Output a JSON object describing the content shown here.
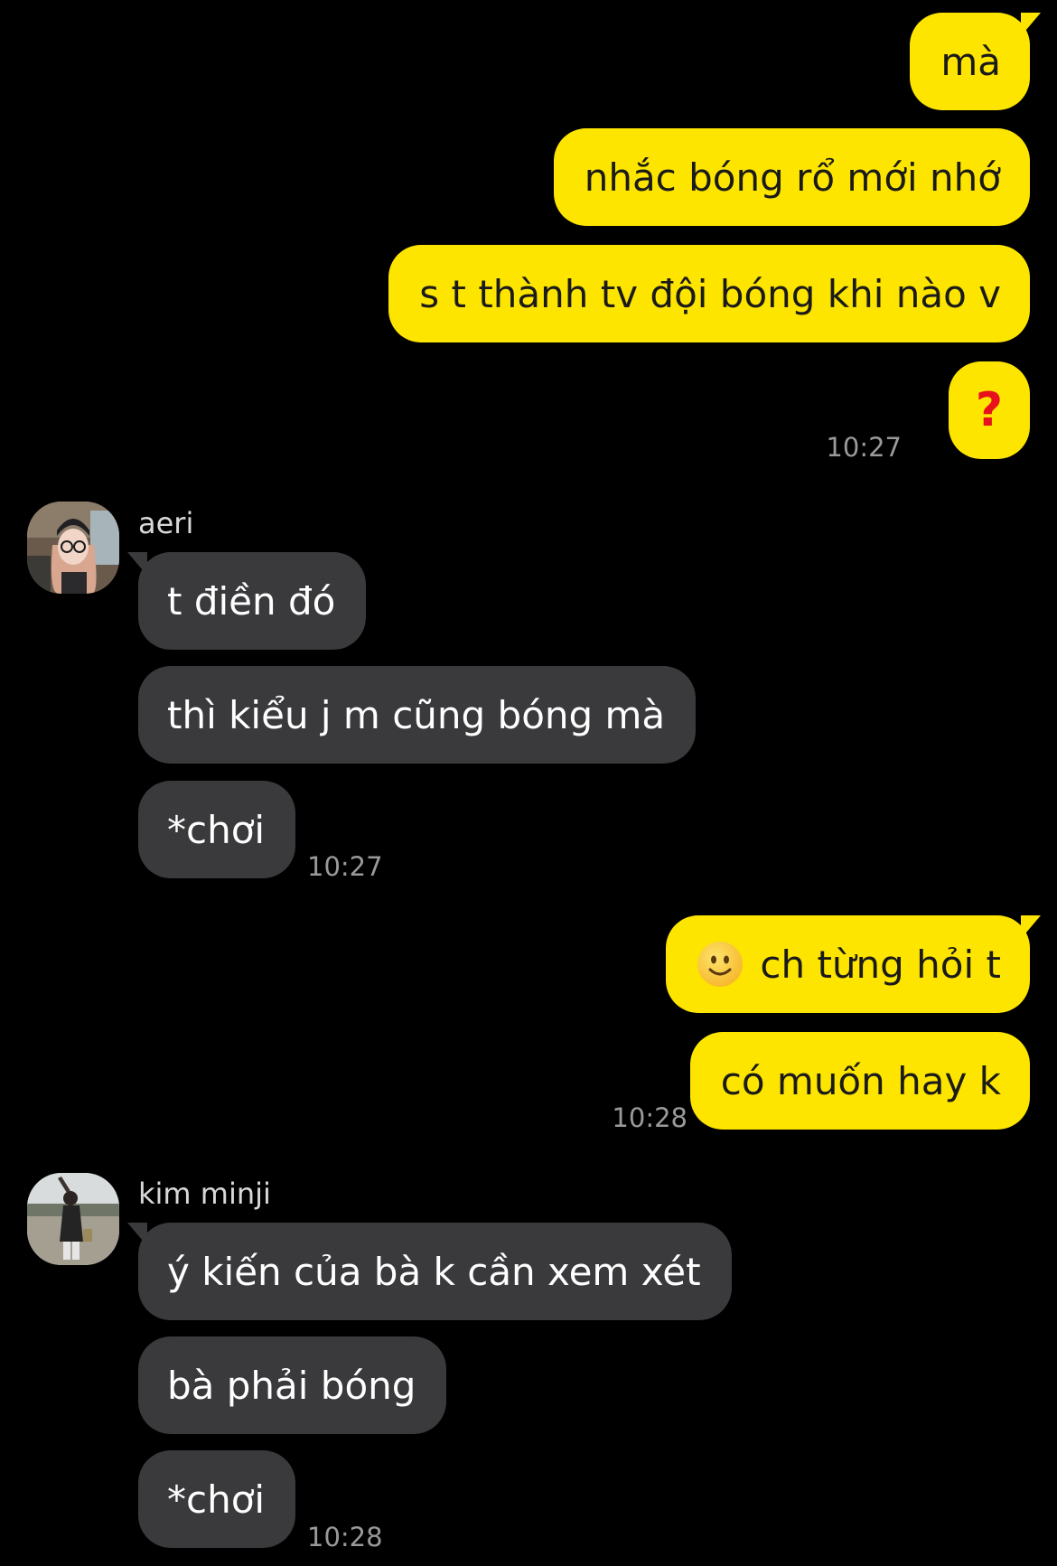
{
  "app": {
    "accent_color": "#fee500",
    "incoming_bubble_color": "#3a3a3c",
    "background_color": "#000000"
  },
  "messages": {
    "block1": {
      "m1": "mà",
      "m2": "nhắc bóng rổ mới nhớ",
      "m3": "s t thành tv đội bóng khi nào v",
      "m4": "?",
      "time": "10:27"
    },
    "block2": {
      "sender": "aeri",
      "m1": "t điền đó",
      "m2": "thì kiểu j m cũng bóng mà",
      "m3": "*chơi",
      "time": "10:27"
    },
    "block3": {
      "m1_emoji": "slightly-smiling-face-emoji",
      "m1": "ch từng hỏi t",
      "m2": "có muốn hay k",
      "time": "10:28"
    },
    "block4": {
      "sender": "kim minji",
      "m1": "ý kiến của bà k cần xem xét",
      "m2": "bà phải bóng",
      "m3": "*chơi",
      "time": "10:28"
    }
  }
}
